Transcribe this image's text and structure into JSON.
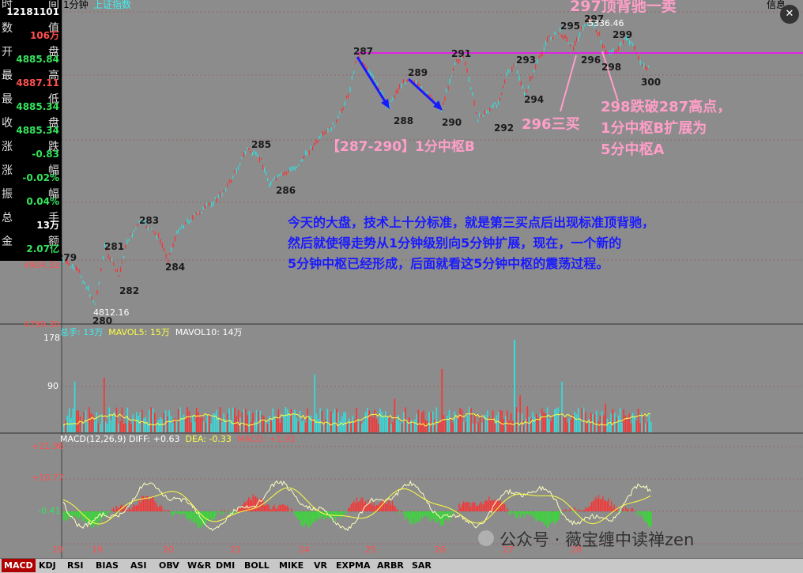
{
  "header": {
    "timeframe": "1分钟",
    "index_name": "上证指数"
  },
  "left_panel": {
    "rows": [
      {
        "label": "时",
        "label2": "间",
        "value": "12181101",
        "color": "#ffffff"
      },
      {
        "label": "数",
        "label2": "值",
        "value": "106万",
        "color": "#ff5050"
      },
      {
        "label": "开",
        "label2": "盘",
        "value": "4885.84",
        "color": "#35e35d"
      },
      {
        "label": "最",
        "label2": "高",
        "value": "4887.11",
        "color": "#ff5050"
      },
      {
        "label": "最",
        "label2": "低",
        "value": "4885.34",
        "color": "#35e35d"
      },
      {
        "label": "收",
        "label2": "盘",
        "value": "4885.34",
        "color": "#35e35d"
      },
      {
        "label": "涨",
        "label2": "跌",
        "value": "-0.83",
        "color": "#35e35d"
      },
      {
        "label": "涨",
        "label2": "幅",
        "value": "-0.02%",
        "color": "#35e35d"
      },
      {
        "label": "振",
        "label2": "幅",
        "value": "0.04%",
        "color": "#35e35d"
      },
      {
        "label": "总",
        "label2": "手",
        "value": "13万",
        "color": "#ffffff"
      },
      {
        "label": "金",
        "label2": "额",
        "value": "2.07亿",
        "color": "#35e35d"
      }
    ]
  },
  "price_axis": {
    "high_label": "5336.46",
    "low_label": "4812.16",
    "bottom_label": "4789.30",
    "left_mid_label": "4904.32"
  },
  "price_chart": {
    "wave_labels": [
      {
        "text": "279"
      },
      {
        "text": "280"
      },
      {
        "text": "281"
      },
      {
        "text": "282"
      },
      {
        "text": "283"
      },
      {
        "text": "284"
      },
      {
        "text": "285"
      },
      {
        "text": "286"
      },
      {
        "text": "287"
      },
      {
        "text": "288"
      },
      {
        "text": "289"
      },
      {
        "text": "290"
      },
      {
        "text": "291"
      },
      {
        "text": "292"
      },
      {
        "text": "293"
      },
      {
        "text": "294"
      },
      {
        "text": "295"
      },
      {
        "text": "296"
      },
      {
        "text": "297"
      },
      {
        "text": "298"
      },
      {
        "text": "299"
      },
      {
        "text": "300"
      }
    ]
  },
  "annotations": {
    "top_sell": "297顶背驰一卖",
    "third_buy": "296三买",
    "zone_b": "【287-290】1分中枢B",
    "break_note_1": "298跌破287高点，",
    "break_note_2": "1分中枢B扩展为",
    "break_note_3": "5分中枢A",
    "commentary_1": "今天的大盘，技术上十分标准，就是第三买点后出现标准顶背驰，",
    "commentary_2": "然后就使得走势从1分钟级别向5分钟扩展，现在，一个新的",
    "commentary_3": "5分钟中枢已经形成，后面就看这5分钟中枢的震荡过程。"
  },
  "volume_panel": {
    "legend_total": "总手: 13万",
    "legend_ma5": "MAVOL5: 15万",
    "legend_ma10": "MAVOL10: 14万",
    "axis_top": "178",
    "axis_mid": "90"
  },
  "macd_panel": {
    "legend_name": "MACD(12,26,9)",
    "legend_diff": "DIFF: +0.63",
    "legend_dea": "DEA: -0.33",
    "legend_macd": "MACD: +1.92",
    "axis_top": "+21.96",
    "axis_mid": "+10.77",
    "axis_zero": "-0.41"
  },
  "time_axis": [
    "19",
    "19",
    "20",
    "21",
    "24",
    "25",
    "26",
    "27",
    "28"
  ],
  "watermark": "公众号 · 薇宝缠中读禅zen",
  "top_right_label": "信息",
  "colors": {
    "background": "#8c8c8c",
    "magenta_line": "#ff00ff",
    "up_candle": "#ff3030",
    "down_candle": "#30e0e0",
    "annotation_pink": "#ff9ec8",
    "annotation_blue": "#1a1aff"
  },
  "bottom_tabs": [
    "MACD",
    "KDJ",
    "RSI",
    "BIAS",
    "ASI",
    "OBV",
    "W&R",
    "DMI",
    "BOLL",
    "MIKE",
    "VR",
    "EXPMA",
    "ARBR",
    "SAR"
  ],
  "active_tab": "MACD"
}
